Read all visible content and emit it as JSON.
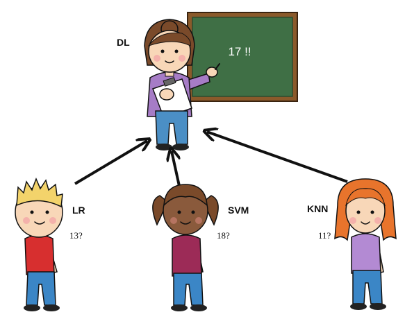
{
  "teacher": {
    "label": "DL",
    "board_text": "17 !!"
  },
  "students": [
    {
      "label": "LR",
      "guess": "13?"
    },
    {
      "label": "SVM",
      "guess": "18?"
    },
    {
      "label": "KNN",
      "guess": "11?"
    }
  ],
  "colors": {
    "board_fill": "#3f6f45",
    "board_frame": "#8b5a2b",
    "teacher_shirt": "#a67cc6",
    "teacher_pants": "#4b8fc5",
    "lr_shirt": "#d72f2f",
    "svm_shirt": "#9c2b57",
    "knn_shirt": "#b38ad3",
    "jeans": "#3b86c6",
    "arrow": "#111111"
  }
}
